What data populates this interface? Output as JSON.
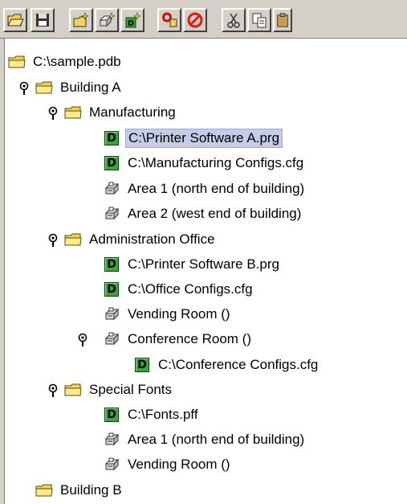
{
  "toolbar": {
    "buttons": [
      {
        "name": "open-folder-icon"
      },
      {
        "name": "save-disk-icon"
      },
      {
        "name": "new-folder-icon"
      },
      {
        "name": "new-printer-icon"
      },
      {
        "name": "new-download-icon"
      },
      {
        "name": "properties-icon"
      },
      {
        "name": "delete-icon"
      },
      {
        "name": "cut-icon"
      },
      {
        "name": "copy-icon"
      },
      {
        "name": "paste-icon"
      }
    ]
  },
  "tree": {
    "root": "C:\\sample.pdb",
    "building_a": {
      "label": "Building A",
      "manufacturing": {
        "label": "Manufacturing",
        "items": [
          "C:\\Printer Software A.prg",
          "C:\\Manufacturing Configs.cfg",
          "Area 1 (north end of building)",
          "Area 2 (west end of building)"
        ]
      },
      "admin": {
        "label": "Administration Office",
        "items": [
          "C:\\Printer Software B.prg",
          "C:\\Office Configs.cfg",
          "Vending Room ()",
          "Conference Room ()"
        ],
        "conference_child": "C:\\Conference Configs.cfg"
      },
      "fonts": {
        "label": "Special Fonts",
        "items": [
          "C:\\Fonts.pff",
          "Area 1 (north end of building)",
          "Vending Room ()"
        ]
      }
    },
    "building_b": {
      "label": "Building B"
    },
    "selected": "C:\\Printer Software A.prg",
    "colors": {
      "selection": "#c6cce8",
      "download_icon": "#3ca43c",
      "folder": "#f2d35a"
    }
  }
}
